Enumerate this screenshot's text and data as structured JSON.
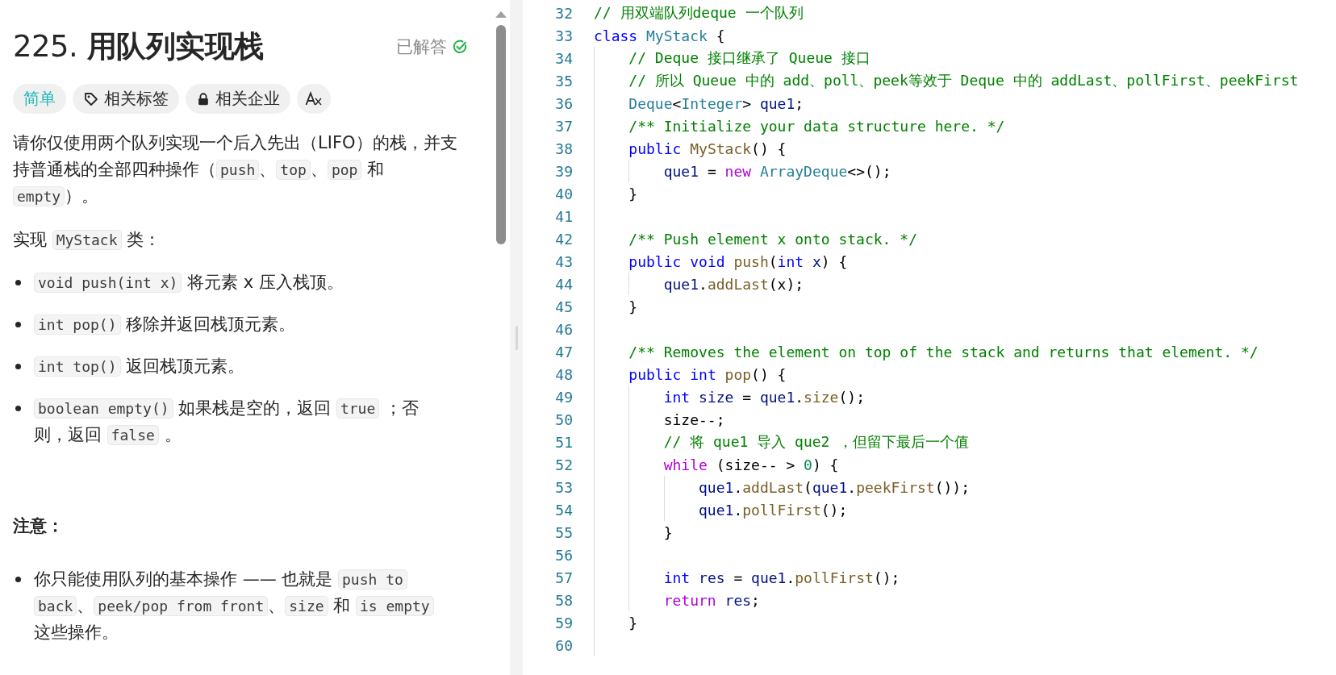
{
  "problem": {
    "title": "225. **用队列实现栈**",
    "status": {
      "label": "已解答",
      "solved": true
    },
    "tags": [
      {
        "kind": "difficulty",
        "label": "简单"
      },
      {
        "kind": "tag",
        "label": "相关标签"
      },
      {
        "kind": "company",
        "label": "相关企业"
      },
      {
        "kind": "translate"
      }
    ],
    "blocks": [
      {
        "kind": "paragraph",
        "segments": [
          {
            "kind": "text",
            "text": "请你仅使用两个队列实现一个后入先出（LIFO）的栈，并支持普通栈的全部四种操作（"
          },
          {
            "kind": "code",
            "text": "push"
          },
          {
            "kind": "text",
            "text": "、"
          },
          {
            "kind": "code",
            "text": "top"
          },
          {
            "kind": "text",
            "text": "、"
          },
          {
            "kind": "code",
            "text": "pop"
          },
          {
            "kind": "text",
            "text": " 和 "
          },
          {
            "kind": "code",
            "text": "empty"
          },
          {
            "kind": "text",
            "text": "）。"
          }
        ]
      },
      {
        "kind": "paragraph",
        "segments": [
          {
            "kind": "text",
            "text": "实现 "
          },
          {
            "kind": "code",
            "text": "MyStack"
          },
          {
            "kind": "text",
            "text": " 类："
          }
        ]
      },
      {
        "kind": "list",
        "items": [
          {
            "segments": [
              {
                "kind": "code",
                "text": "void push(int x)"
              },
              {
                "kind": "text",
                "text": " 将元素 x 压入栈顶。"
              }
            ]
          },
          {
            "segments": [
              {
                "kind": "code",
                "text": "int pop()"
              },
              {
                "kind": "text",
                "text": " 移除并返回栈顶元素。"
              }
            ]
          },
          {
            "segments": [
              {
                "kind": "code",
                "text": "int top()"
              },
              {
                "kind": "text",
                "text": " 返回栈顶元素。"
              }
            ]
          },
          {
            "segments": [
              {
                "kind": "code",
                "text": "boolean empty()"
              },
              {
                "kind": "text",
                "text": " 如果栈是空的，返回 "
              },
              {
                "kind": "code",
                "text": "true"
              },
              {
                "kind": "text",
                "text": " ；否则，返回 "
              },
              {
                "kind": "code",
                "text": "false"
              },
              {
                "kind": "text",
                "text": " 。"
              }
            ]
          }
        ]
      },
      {
        "kind": "heading",
        "text": "注意："
      },
      {
        "kind": "list",
        "items": [
          {
            "segments": [
              {
                "kind": "text",
                "text": "你只能使用队列的基本操作 —— 也就是 "
              },
              {
                "kind": "code",
                "text": "push to back"
              },
              {
                "kind": "text",
                "text": "、"
              },
              {
                "kind": "code",
                "text": "peek/pop from front"
              },
              {
                "kind": "text",
                "text": "、"
              },
              {
                "kind": "code",
                "text": "size"
              },
              {
                "kind": "text",
                "text": " 和 "
              },
              {
                "kind": "code",
                "text": "is empty"
              },
              {
                "kind": "text",
                "text": " 这些操作。"
              }
            ]
          }
        ]
      }
    ]
  },
  "editor": {
    "lines": [
      {
        "number": "32",
        "tokens": [
          {
            "kind": "comment",
            "text": "// 用双端队列deque 一个队列"
          }
        ]
      },
      {
        "number": "33",
        "tokens": [
          {
            "kind": "keyword",
            "text": "class"
          },
          {
            "kind": "type",
            "text": " MyStack"
          },
          {
            "kind": "plain",
            "text": " {"
          }
        ]
      },
      {
        "number": "34",
        "tokens": [
          {
            "kind": "comment",
            "text": "    // Deque 接口继承了 Queue 接口"
          }
        ]
      },
      {
        "number": "35",
        "tokens": [
          {
            "kind": "comment",
            "text": "    // 所以 Queue 中的 add、poll、peek等效于 Deque 中的 addLast、pollFirst、peekFirst"
          }
        ]
      },
      {
        "number": "36",
        "tokens": [
          {
            "kind": "type",
            "text": "    Deque"
          },
          {
            "kind": "plain",
            "text": "<"
          },
          {
            "kind": "type",
            "text": "Integer"
          },
          {
            "kind": "plain",
            "text": ">"
          },
          {
            "kind": "variable",
            "text": " que1"
          },
          {
            "kind": "plain",
            "text": ";"
          }
        ]
      },
      {
        "number": "37",
        "tokens": [
          {
            "kind": "comment",
            "text": "    /** Initialize your data structure here. */"
          }
        ]
      },
      {
        "number": "38",
        "tokens": [
          {
            "kind": "keyword",
            "text": "    public"
          },
          {
            "kind": "method",
            "text": " MyStack"
          },
          {
            "kind": "plain",
            "text": "() {"
          }
        ]
      },
      {
        "number": "39",
        "tokens": [
          {
            "kind": "variable",
            "text": "        que1"
          },
          {
            "kind": "plain",
            "text": " ="
          },
          {
            "kind": "control",
            "text": " new"
          },
          {
            "kind": "type",
            "text": " ArrayDeque"
          },
          {
            "kind": "plain",
            "text": "<>();"
          }
        ]
      },
      {
        "number": "40",
        "tokens": [
          {
            "kind": "plain",
            "text": "    }"
          }
        ]
      },
      {
        "number": "41"
      },
      {
        "number": "42",
        "tokens": [
          {
            "kind": "comment",
            "text": "    /** Push element x onto stack. */"
          }
        ]
      },
      {
        "number": "43",
        "tokens": [
          {
            "kind": "keyword",
            "text": "    public void"
          },
          {
            "kind": "method",
            "text": " push"
          },
          {
            "kind": "plain",
            "text": "("
          },
          {
            "kind": "keyword",
            "text": "int"
          },
          {
            "kind": "variable",
            "text": " x"
          },
          {
            "kind": "plain",
            "text": ") {"
          }
        ]
      },
      {
        "number": "44",
        "tokens": [
          {
            "kind": "variable",
            "text": "        que1"
          },
          {
            "kind": "plain",
            "text": "."
          },
          {
            "kind": "method",
            "text": "addLast"
          },
          {
            "kind": "plain",
            "text": "(x);"
          }
        ]
      },
      {
        "number": "45",
        "tokens": [
          {
            "kind": "plain",
            "text": "    }"
          }
        ]
      },
      {
        "number": "46"
      },
      {
        "number": "47",
        "tokens": [
          {
            "kind": "comment",
            "text": "    /** Removes the element on top of the stack and returns that element. */"
          }
        ]
      },
      {
        "number": "48",
        "tokens": [
          {
            "kind": "keyword",
            "text": "    public int"
          },
          {
            "kind": "method",
            "text": " pop"
          },
          {
            "kind": "plain",
            "text": "() {"
          }
        ]
      },
      {
        "number": "49",
        "tokens": [
          {
            "kind": "keyword",
            "text": "        int"
          },
          {
            "kind": "variable",
            "text": " size"
          },
          {
            "kind": "plain",
            "text": " ="
          },
          {
            "kind": "variable",
            "text": " que1"
          },
          {
            "kind": "plain",
            "text": "."
          },
          {
            "kind": "method",
            "text": "size"
          },
          {
            "kind": "plain",
            "text": "();"
          }
        ]
      },
      {
        "number": "50",
        "tokens": [
          {
            "kind": "plain",
            "text": "        size--;"
          }
        ]
      },
      {
        "number": "51",
        "tokens": [
          {
            "kind": "comment",
            "text": "        // 将 que1 导入 que2 ，但留下最后一个值"
          }
        ]
      },
      {
        "number": "52",
        "tokens": [
          {
            "kind": "control",
            "text": "        while"
          },
          {
            "kind": "plain",
            "text": " (size-- >"
          },
          {
            "kind": "number",
            "text": " 0"
          },
          {
            "kind": "plain",
            "text": ") {"
          }
        ]
      },
      {
        "number": "53",
        "tokens": [
          {
            "kind": "variable",
            "text": "            que1"
          },
          {
            "kind": "plain",
            "text": "."
          },
          {
            "kind": "method",
            "text": "addLast"
          },
          {
            "kind": "plain",
            "text": "("
          },
          {
            "kind": "variable",
            "text": "que1"
          },
          {
            "kind": "plain",
            "text": "."
          },
          {
            "kind": "method",
            "text": "peekFirst"
          },
          {
            "kind": "plain",
            "text": "());"
          }
        ]
      },
      {
        "number": "54",
        "tokens": [
          {
            "kind": "variable",
            "text": "            que1"
          },
          {
            "kind": "plain",
            "text": "."
          },
          {
            "kind": "method",
            "text": "pollFirst"
          },
          {
            "kind": "plain",
            "text": "();"
          }
        ]
      },
      {
        "number": "55",
        "tokens": [
          {
            "kind": "plain",
            "text": "        }"
          }
        ]
      },
      {
        "number": "56"
      },
      {
        "number": "57",
        "tokens": [
          {
            "kind": "keyword",
            "text": "        int"
          },
          {
            "kind": "variable",
            "text": " res"
          },
          {
            "kind": "plain",
            "text": " ="
          },
          {
            "kind": "variable",
            "text": " que1"
          },
          {
            "kind": "plain",
            "text": "."
          },
          {
            "kind": "method",
            "text": "pollFirst"
          },
          {
            "kind": "plain",
            "text": "();"
          }
        ]
      },
      {
        "number": "58",
        "tokens": [
          {
            "kind": "control",
            "text": "        return"
          },
          {
            "kind": "variable",
            "text": " res"
          },
          {
            "kind": "plain",
            "text": ";"
          }
        ]
      },
      {
        "number": "59",
        "tokens": [
          {
            "kind": "plain",
            "text": "    }"
          }
        ]
      },
      {
        "number": "60"
      }
    ]
  }
}
